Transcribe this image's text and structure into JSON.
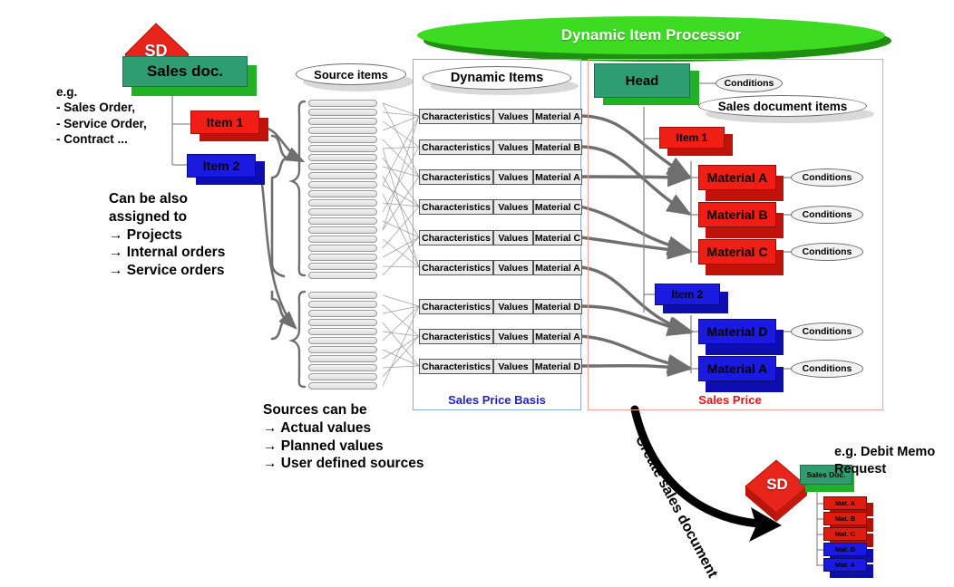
{
  "diagram": {
    "title": "Dynamic Item Processor",
    "banner": {
      "label": "Dynamic Item Processor",
      "color": "#3ddb22",
      "shadow_color": "#1e8f10"
    }
  },
  "left": {
    "sd_badge": "SD",
    "sales_doc": "Sales doc.",
    "examples": "e.g.\n- Sales Order,\n- Service Order,\n- Contract ...",
    "items": [
      "Item 1",
      "Item 2"
    ],
    "assigned_note": "Can be also\nassigned to\n→ Projects\n→ Internal orders\n→ Service orders",
    "sources_note": "Sources can be\n→ Actual values\n→ Planned values\n→ User defined sources"
  },
  "source_items": {
    "label": "Source items",
    "group_upper_count": 20,
    "group_lower_count": 11
  },
  "dynamic_items": {
    "label": "Dynamic Items",
    "panel_label": "Sales Price Basis",
    "panel_border_color": "#8fa8e8",
    "panel_label_color": "#2222cc",
    "columns": [
      "Characteristics",
      "Values",
      "Material"
    ],
    "rows": [
      {
        "characteristics": "Characteristics",
        "values": "Values",
        "material": "Material A",
        "group": "upper"
      },
      {
        "characteristics": "Characteristics",
        "values": "Values",
        "material": "Material B",
        "group": "upper"
      },
      {
        "characteristics": "Characteristics",
        "values": "Values",
        "material": "Material A",
        "group": "upper"
      },
      {
        "characteristics": "Characteristics",
        "values": "Values",
        "material": "Material C",
        "group": "upper"
      },
      {
        "characteristics": "Characteristics",
        "values": "Values",
        "material": "Material C",
        "group": "upper"
      },
      {
        "characteristics": "Characteristics",
        "values": "Values",
        "material": "Material A",
        "group": "upper"
      },
      {
        "characteristics": "Characteristics",
        "values": "Values",
        "material": "Material D",
        "group": "lower"
      },
      {
        "characteristics": "Characteristics",
        "values": "Values",
        "material": "Material A",
        "group": "lower"
      },
      {
        "characteristics": "Characteristics",
        "values": "Values",
        "material": "Material D",
        "group": "lower"
      }
    ]
  },
  "sales_price": {
    "panel_label": "Sales Price",
    "panel_border_color": "#f2a0a0",
    "panel_label_color": "#ee1111",
    "head": "Head",
    "head_condition": "Conditions",
    "sales_document_items": "Sales document items",
    "item1": "Item 1",
    "item2": "Item 2",
    "materials_item1": [
      {
        "name": "Material A",
        "condition": "Conditions",
        "color": "#f01e14"
      },
      {
        "name": "Material B",
        "condition": "Conditions",
        "color": "#f01e14"
      },
      {
        "name": "Material C",
        "condition": "Conditions",
        "color": "#f01e14"
      }
    ],
    "materials_item2": [
      {
        "name": "Material D",
        "condition": "Conditions",
        "color": "#1a1ae0"
      },
      {
        "name": "Material A",
        "condition": "Conditions",
        "color": "#1a1ae0"
      }
    ]
  },
  "output": {
    "arrow_label": "Create sales document",
    "sd_badge": "SD",
    "sales_doc": "Sales Doc.",
    "note": "e.g. Debit Memo\nRequest",
    "materials": [
      {
        "name": "Mat. A",
        "color": "#e01b10"
      },
      {
        "name": "Mat. B",
        "color": "#e01b10"
      },
      {
        "name": "Mat. C",
        "color": "#e01b10"
      },
      {
        "name": "Mat. D",
        "color": "#1a1ae0"
      },
      {
        "name": "Mat. A",
        "color": "#1a1ae0"
      }
    ]
  },
  "colors": {
    "green_doc": "#2e9e72",
    "green_doc_shadow": "#22b024",
    "red": "#f01e14",
    "red_shadow": "#bf1208",
    "blue": "#1a1ae0",
    "blue_shadow": "#0d0db0",
    "sd_red": "#e8251a",
    "connector_gray": "#6f6f6f"
  }
}
